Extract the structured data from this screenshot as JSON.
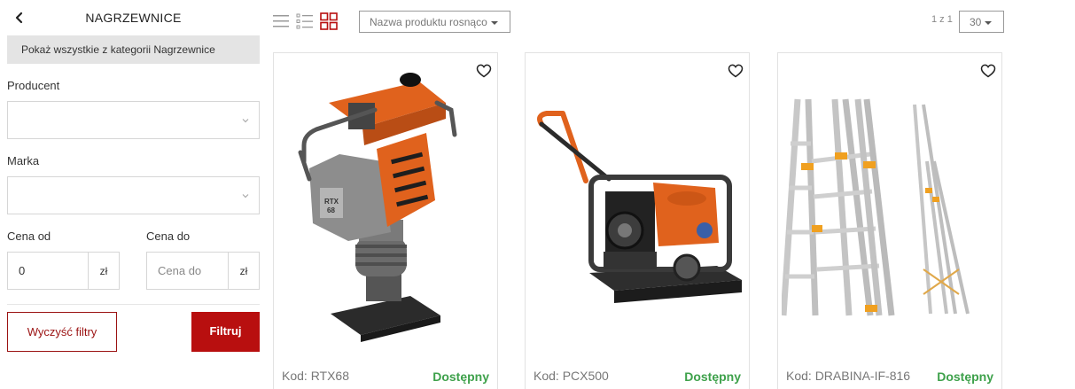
{
  "category": {
    "title": "NAGRZEWNICE",
    "show_all": "Pokaż wszystkie z kategorii Nagrzewnice"
  },
  "filters": {
    "producer_label": "Producent",
    "producer_value": "",
    "brand_label": "Marka",
    "brand_value": "",
    "price_from_label": "Cena od",
    "price_from_value": "0",
    "price_to_label": "Cena do",
    "price_to_placeholder": "Cena do",
    "currency": "zł",
    "clear_label": "Wyczyść filtry",
    "filter_label": "Filtruj"
  },
  "toolbar": {
    "sort_value": "Nazwa produktu rosnąco",
    "pagination": "1 z 1",
    "per_page": "30",
    "active_view": "grid"
  },
  "colors": {
    "accent": "#b80f0f",
    "available": "#3ea14b"
  },
  "products": [
    {
      "code": "Kod: RTX68",
      "availability": "Dostępny",
      "image": "rammer"
    },
    {
      "code": "Kod: PCX500",
      "availability": "Dostępny",
      "image": "plate-compactor"
    },
    {
      "code": "Kod: DRABINA-IF-816",
      "availability": "Dostępny",
      "image": "ladder"
    }
  ]
}
